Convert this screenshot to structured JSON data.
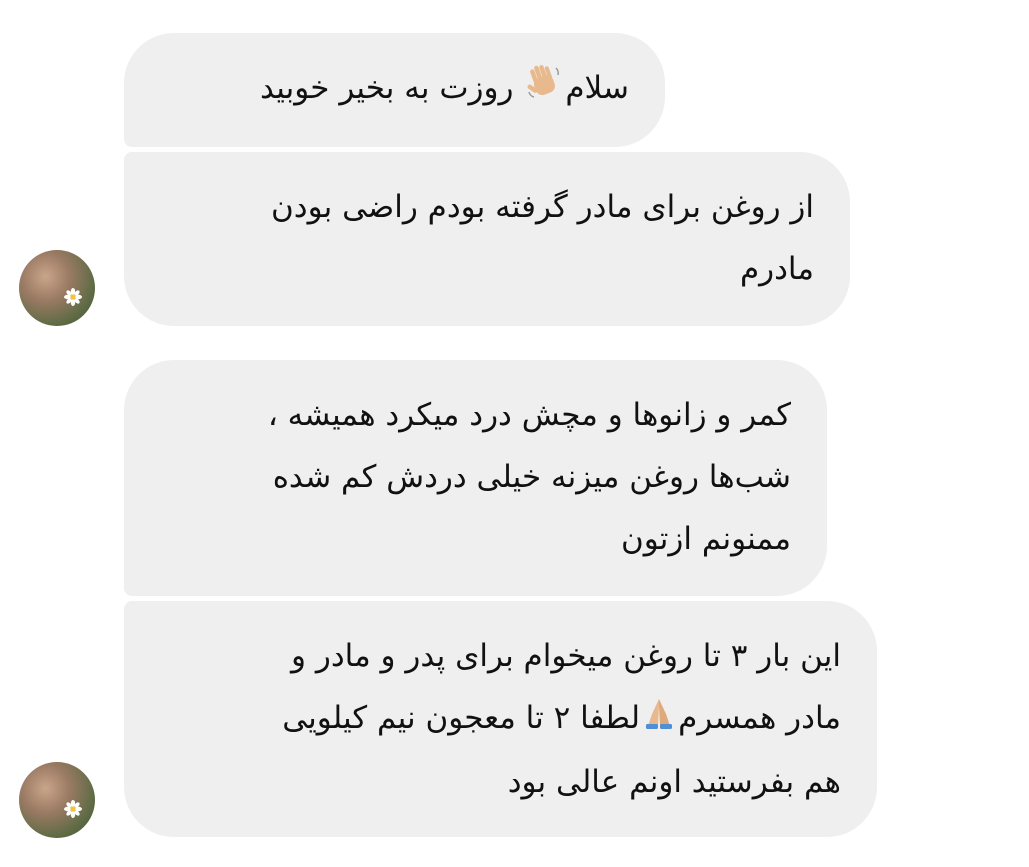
{
  "messages": [
    {
      "id": "msg-1",
      "parts": [
        "سلام",
        "wave",
        " روزت به بخیر خوبید"
      ]
    },
    {
      "id": "msg-2",
      "lines": [
        "از روغن برای مادر گرفته بودم راضی بودن",
        "مادرم"
      ]
    },
    {
      "id": "msg-3",
      "lines": [
        "کمر و زانوها و مچش درد میکرد همیشه ،",
        "شب‌ها روغن میزنه خیلی دردش کم شده",
        "ممنونم ازتون"
      ]
    },
    {
      "id": "msg-4",
      "line1": "این بار ۳ تا روغن میخوام برای پدر و مادر و",
      "line2_before": "مادر همسرم",
      "line2_after": "لطفا ۲ تا معجون نیم کیلویی",
      "line3": "هم بفرستید اونم عالی بود"
    }
  ],
  "icons": {
    "wave": "waving-hand-icon",
    "pray": "folded-hands-icon",
    "avatar": "sender-avatar"
  },
  "colors": {
    "bubble_bg": "#efefef",
    "text": "#111111",
    "page_bg": "#ffffff"
  }
}
